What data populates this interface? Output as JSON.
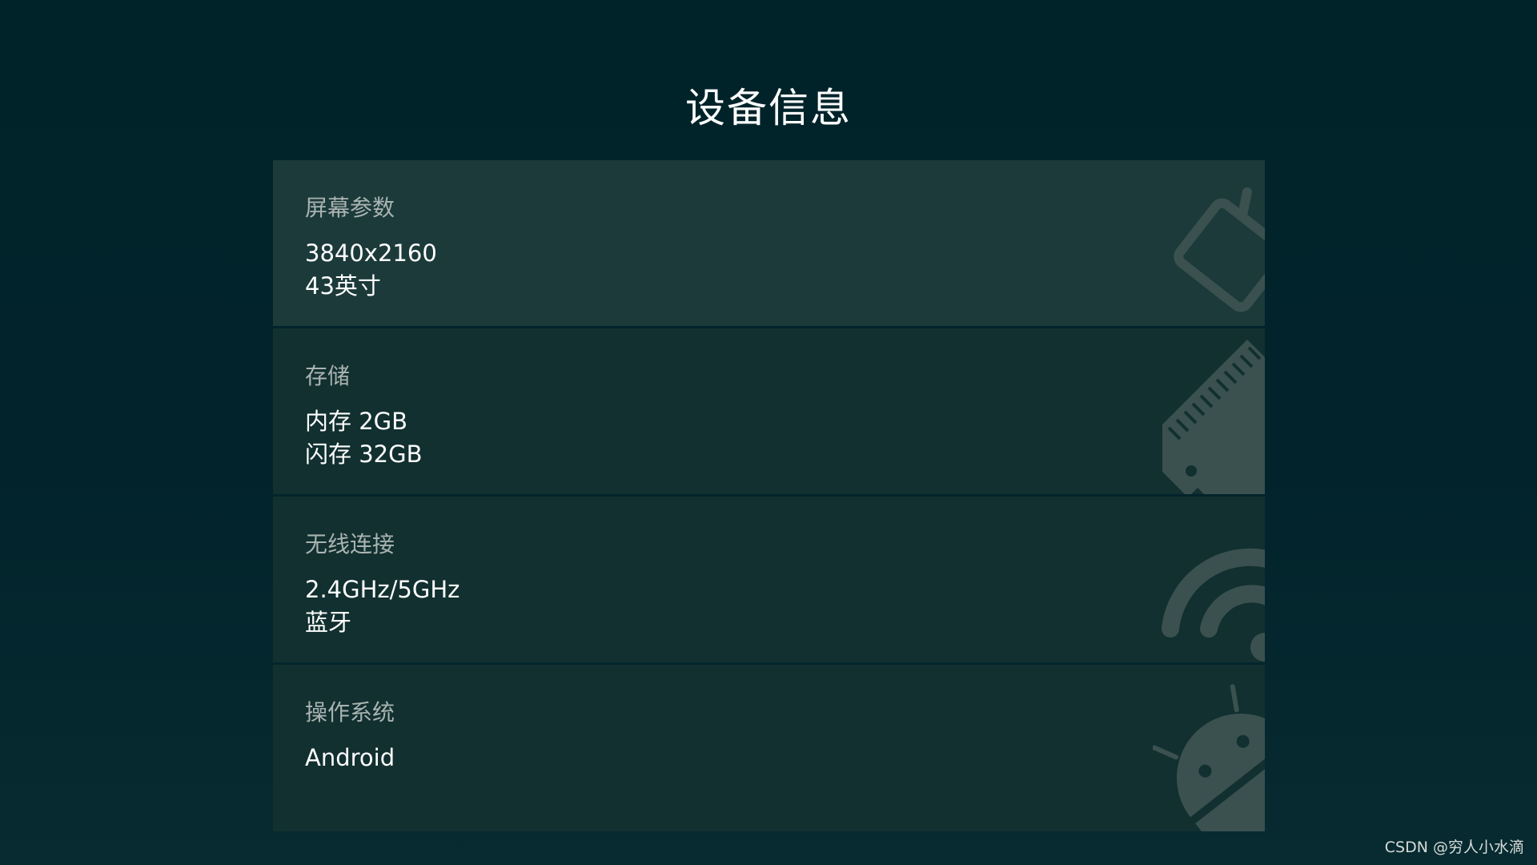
{
  "page": {
    "title": "设备信息"
  },
  "cards": [
    {
      "label": "屏幕参数",
      "values": [
        "3840x2160",
        "43英寸"
      ],
      "icon": "tv-icon",
      "active": true
    },
    {
      "label": "存储",
      "values": [
        "内存 2GB",
        "闪存 32GB"
      ],
      "icon": "memory-chip-icon",
      "active": false
    },
    {
      "label": "无线连接",
      "values": [
        "2.4GHz/5GHz",
        "蓝牙"
      ],
      "icon": "wifi-icon",
      "active": false
    },
    {
      "label": "操作系统",
      "values": [
        "Android"
      ],
      "icon": "android-icon",
      "active": false
    }
  ],
  "watermark": "CSDN @穷人小水滴",
  "colors": {
    "background": "#00222a",
    "card": "#11302f",
    "card_focused": "#1c3a3a",
    "label_text": "#a9b3b1",
    "value_text": "#ffffff",
    "icon_tint": "#3b514f"
  }
}
